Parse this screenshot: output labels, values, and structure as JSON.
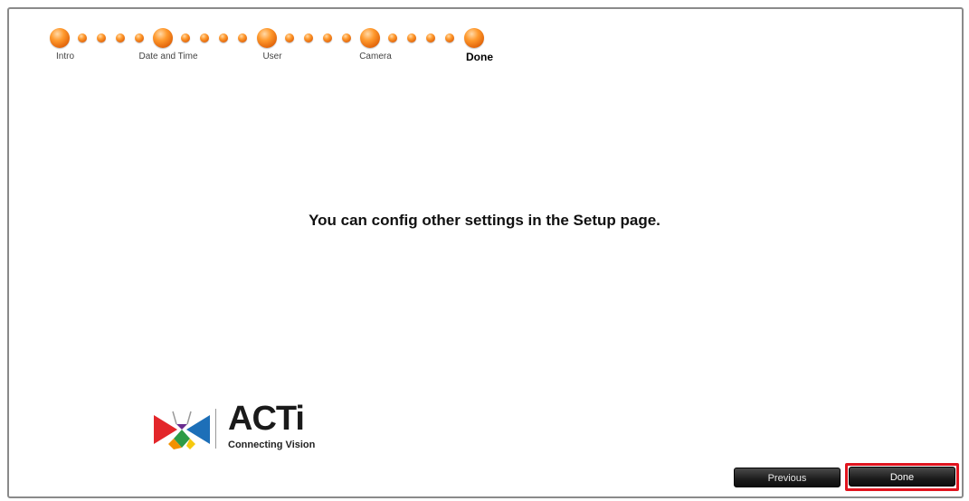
{
  "wizard": {
    "steps": [
      {
        "label": "Intro"
      },
      {
        "label": "Date and Time"
      },
      {
        "label": "User"
      },
      {
        "label": "Camera"
      },
      {
        "label": "Done",
        "current": true
      }
    ]
  },
  "main": {
    "message": "You can config other settings in the Setup page."
  },
  "brand": {
    "name": "ACTi",
    "tagline": "Connecting Vision",
    "colors": {
      "red": "#e3262a",
      "purple": "#6a2c8f",
      "blue": "#1d6fb8",
      "green": "#2e9b46",
      "orange": "#f29100",
      "yellow": "#f6c90e"
    }
  },
  "footer": {
    "previous_label": "Previous",
    "done_label": "Done"
  },
  "accent": {
    "progress": "#f07c12",
    "highlight": "#e0141e"
  }
}
